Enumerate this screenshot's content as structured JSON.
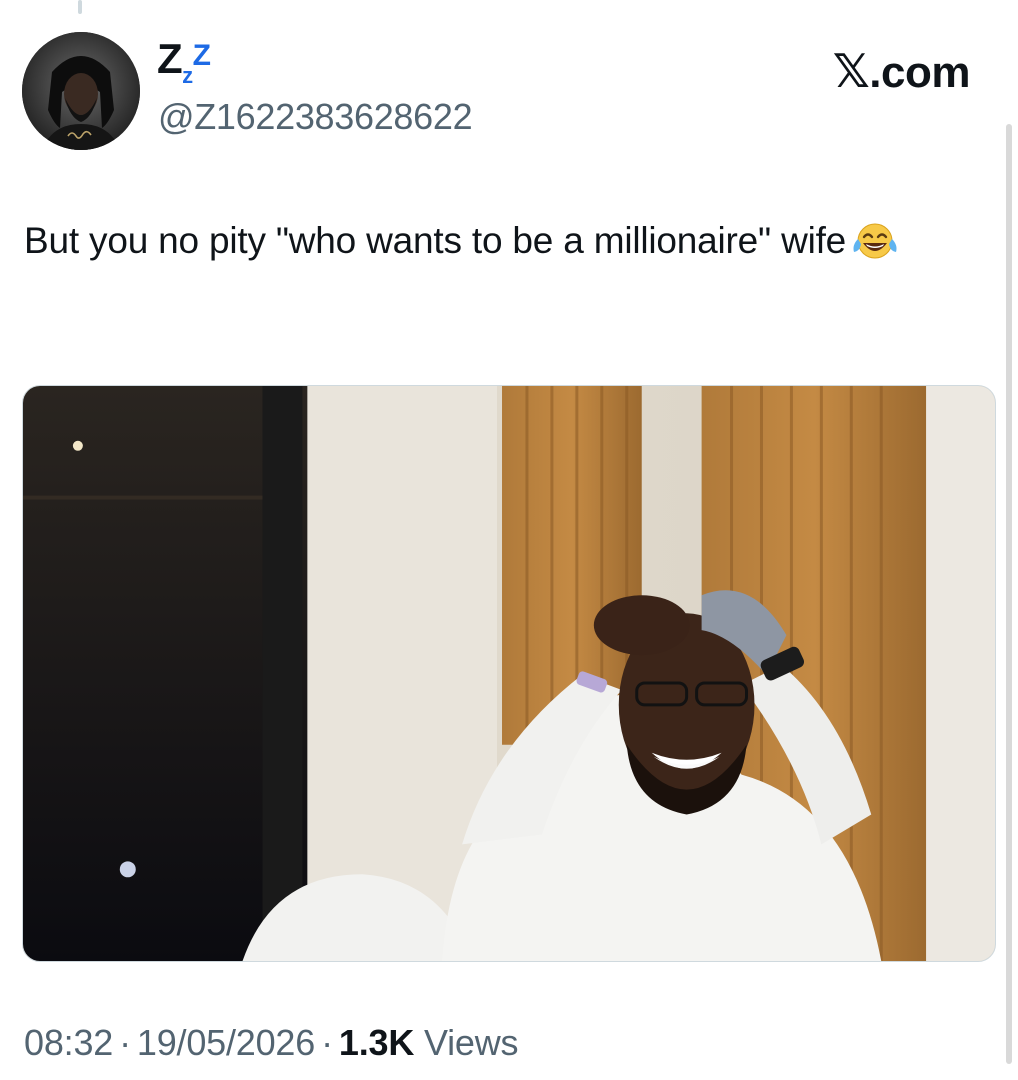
{
  "author": {
    "display_name_parts": [
      "Z",
      "z",
      "Z"
    ],
    "handle": "@Z1622383628622"
  },
  "brand": {
    "label": ".com",
    "mark": "𝕏"
  },
  "tweet": {
    "text": "But you no pity \"who wants to be a millionaire\" wife",
    "emoji_icon": "face-with-tears-of-joy-icon"
  },
  "meta": {
    "time": "08:32",
    "date": "19/05/2026",
    "separator": "·",
    "views_count": "1.3K",
    "views_label": "Views"
  }
}
